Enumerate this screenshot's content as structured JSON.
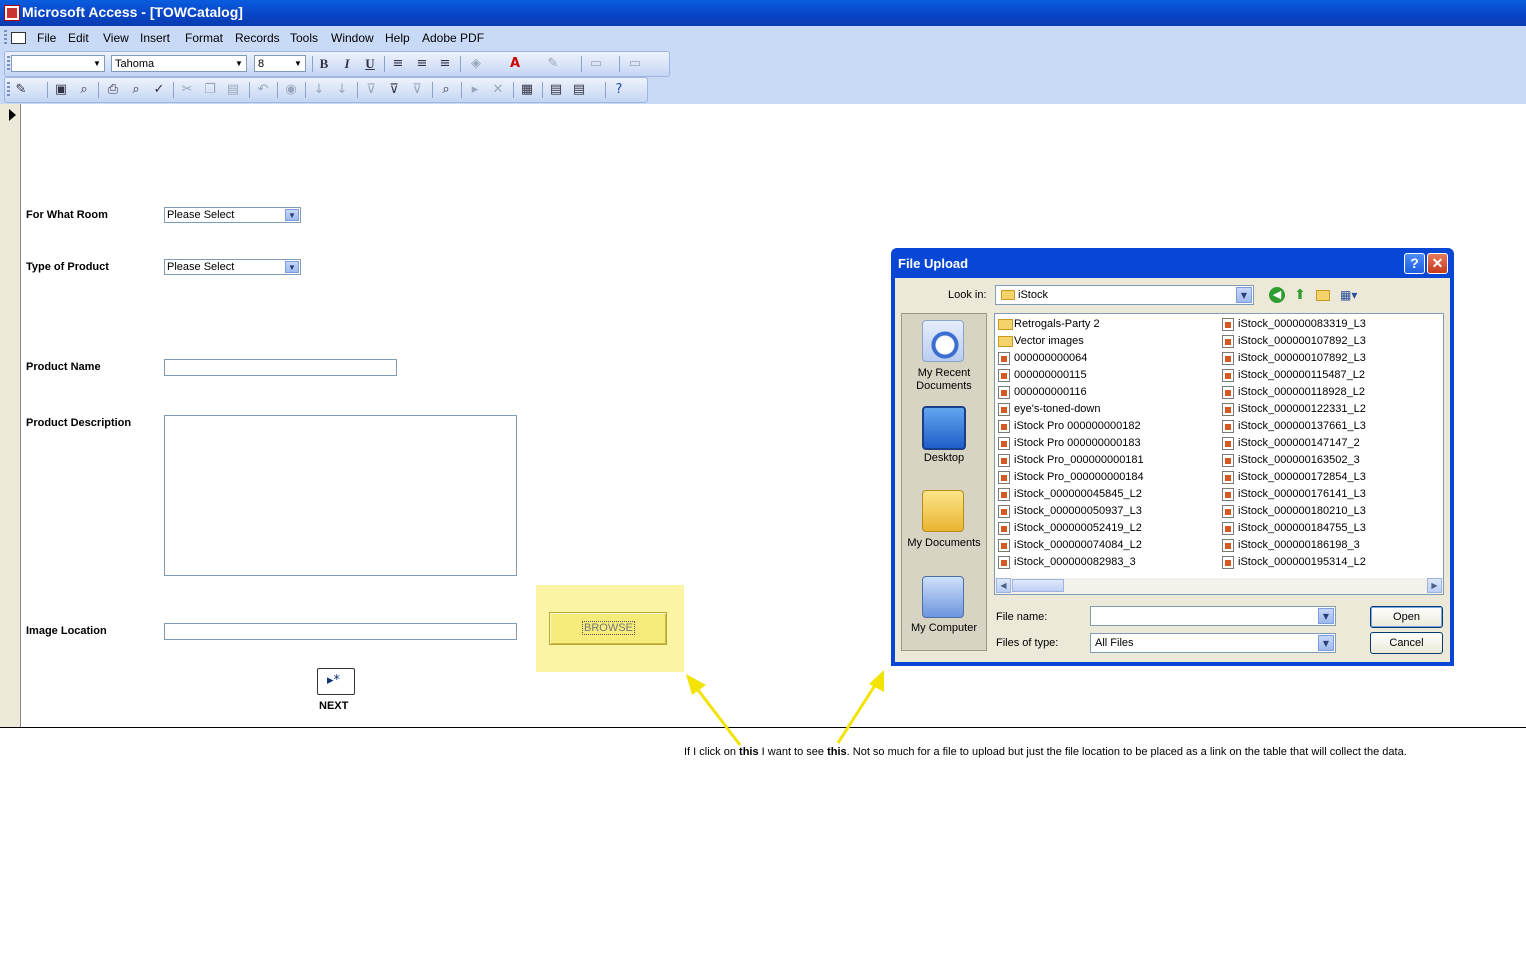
{
  "window": {
    "title": "Microsoft Access - [TOWCatalog]"
  },
  "menu": [
    "File",
    "Edit",
    "View",
    "Insert",
    "Format",
    "Records",
    "Tools",
    "Window",
    "Help",
    "Adobe PDF"
  ],
  "format_toolbar": {
    "object": "",
    "font": "Tahoma",
    "size": "8"
  },
  "form": {
    "room_label": "For What Room",
    "room_value": "Please Select",
    "type_label": "Type of Product",
    "type_value": "Please Select",
    "name_label": "Product Name",
    "desc_label": "Product Description",
    "image_label": "Image Location",
    "browse_label": "BROWSE",
    "next_label": "NEXT"
  },
  "dialog": {
    "title": "File Upload",
    "help": "?",
    "close": "✕",
    "look_in_label": "Look in:",
    "look_in_value": "iStock",
    "places": [
      "My Recent Documents",
      "Desktop",
      "My Documents",
      "My Computer"
    ],
    "files_col1": [
      {
        "name": "Retrogals-Party 2",
        "type": "folder"
      },
      {
        "name": "Vector images",
        "type": "folder"
      },
      {
        "name": "000000000064",
        "type": "file"
      },
      {
        "name": "000000000115",
        "type": "file"
      },
      {
        "name": "000000000116",
        "type": "file"
      },
      {
        "name": "eye's-toned-down",
        "type": "file"
      },
      {
        "name": "iStock Pro 000000000182",
        "type": "file"
      },
      {
        "name": "iStock Pro 000000000183",
        "type": "file"
      },
      {
        "name": "iStock Pro_000000000181",
        "type": "file"
      },
      {
        "name": "iStock Pro_000000000184",
        "type": "file"
      },
      {
        "name": "iStock_000000045845_L2",
        "type": "file"
      },
      {
        "name": "iStock_000000050937_L3",
        "type": "file"
      },
      {
        "name": "iStock_000000052419_L2",
        "type": "file"
      },
      {
        "name": "iStock_000000074084_L2",
        "type": "file"
      },
      {
        "name": "iStock_000000082983_3",
        "type": "file"
      }
    ],
    "files_col2": [
      {
        "name": "iStock_000000083319_L3",
        "type": "file"
      },
      {
        "name": "iStock_000000107892_L3",
        "type": "file"
      },
      {
        "name": "iStock_000000107892_L3",
        "type": "file"
      },
      {
        "name": "iStock_000000115487_L2",
        "type": "file"
      },
      {
        "name": "iStock_000000118928_L2",
        "type": "file"
      },
      {
        "name": "iStock_000000122331_L2",
        "type": "file"
      },
      {
        "name": "iStock_000000137661_L3",
        "type": "file"
      },
      {
        "name": "iStock_000000147147_2",
        "type": "file"
      },
      {
        "name": "iStock_000000163502_3",
        "type": "file"
      },
      {
        "name": "iStock_000000172854_L3",
        "type": "file"
      },
      {
        "name": "iStock_000000176141_L3",
        "type": "file"
      },
      {
        "name": "iStock_000000180210_L3",
        "type": "file"
      },
      {
        "name": "iStock_000000184755_L3",
        "type": "file"
      },
      {
        "name": "iStock_000000186198_3",
        "type": "file"
      },
      {
        "name": "iStock_000000195314_L2",
        "type": "file"
      }
    ],
    "file_name_label": "File name:",
    "file_name_value": "",
    "files_of_type_label": "Files of type:",
    "files_of_type_value": "All Files",
    "open_label": "Open",
    "cancel_label": "Cancel"
  },
  "caption": {
    "p1": "If I click on ",
    "b1": "this",
    "p2": " I want to see ",
    "b2": "this",
    "p3": ".  Not so much for a file to upload but just the file location to be placed as a link on the table that will collect the data."
  },
  "colors": {
    "titlebar": "#0843c4",
    "highlight": "#fbf4a4",
    "arrow": "#f2e400"
  }
}
